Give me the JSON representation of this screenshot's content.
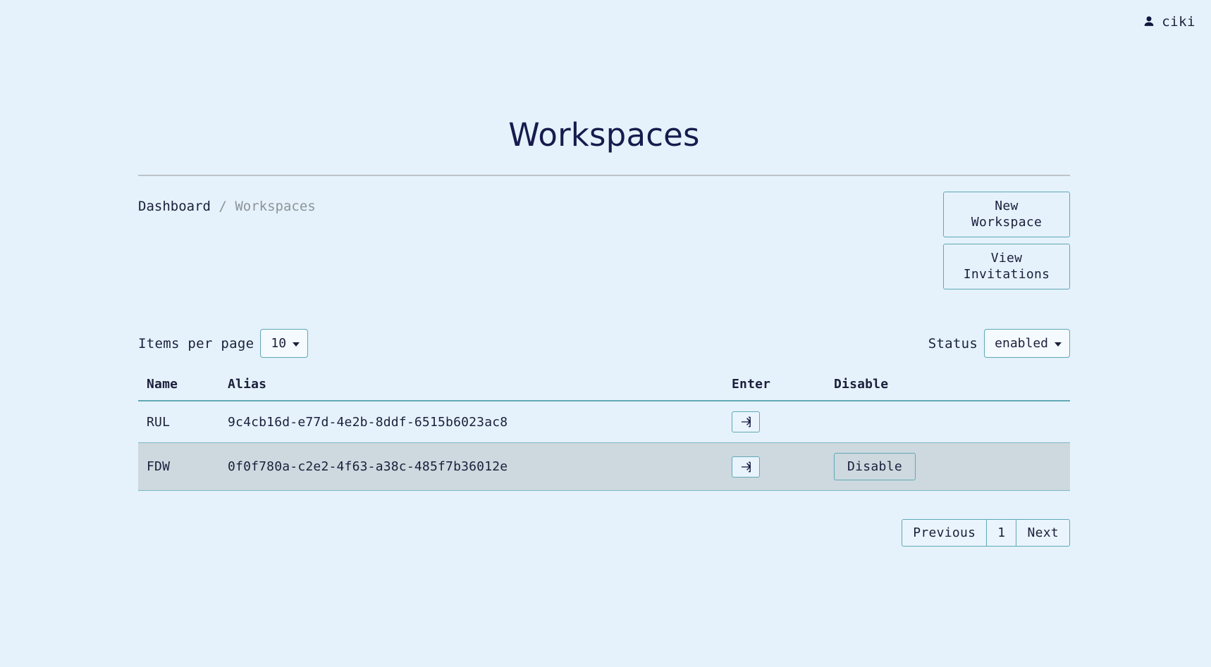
{
  "topbar": {
    "user_icon": "person-icon",
    "username": "ciki"
  },
  "page": {
    "title": "Workspaces"
  },
  "breadcrumb": {
    "root": "Dashboard",
    "separator": "/",
    "current": "Workspaces"
  },
  "actions": {
    "new_workspace": "New Workspace",
    "view_invitations": "View Invitations"
  },
  "controls": {
    "items_per_page_label": "Items per page",
    "items_per_page_value": "10",
    "items_per_page_options": [
      "10"
    ],
    "status_label": "Status",
    "status_value": "enabled",
    "status_options": [
      "enabled"
    ]
  },
  "table": {
    "columns": [
      "Name",
      "Alias",
      "Enter",
      "Disable"
    ],
    "rows": [
      {
        "name": "RUL",
        "alias": "9c4cb16d-e77d-4e2b-8ddf-6515b6023ac8",
        "enter_icon": "box-arrow-in-right-icon",
        "disable_label": "",
        "highlighted": false
      },
      {
        "name": "FDW",
        "alias": "0f0f780a-c2e2-4f63-a38c-485f7b36012e",
        "enter_icon": "box-arrow-in-right-icon",
        "disable_label": "Disable",
        "highlighted": true
      }
    ]
  },
  "pagination": {
    "previous": "Previous",
    "pages": [
      "1"
    ],
    "next": "Next",
    "current_page": "1"
  },
  "colors": {
    "background": "#e5f2fb",
    "accent_border": "#5fa8b5",
    "text": "#1b1f3b",
    "title": "#171b4d",
    "muted": "#8d9399",
    "row_highlight": "#cdd9df",
    "rule": "#bfc3c7"
  }
}
